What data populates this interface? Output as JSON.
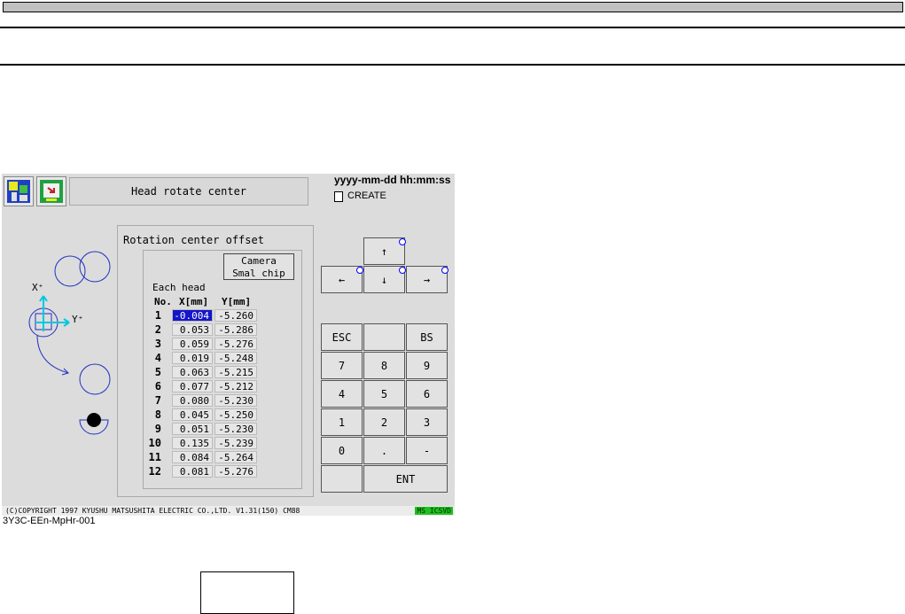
{
  "window": {
    "title": "Head rotate center",
    "datetime": "yyyy-mm-dd  hh:mm:ss",
    "mode": "CREATE"
  },
  "icons": [
    "home-icon",
    "screen-icon",
    "document-icon"
  ],
  "diagram": {
    "x_axis_label": "X⁺",
    "y_axis_label": "Y⁺"
  },
  "offset_panel": {
    "title": "Rotation center offset",
    "camera_button": "Camera\nSmal chip",
    "section_label": "Each head",
    "columns": [
      "No.",
      "X[mm]",
      "Y[mm]"
    ],
    "rows": [
      {
        "no": "1",
        "x": "-0.004",
        "y": "-5.260"
      },
      {
        "no": "2",
        "x": "0.053",
        "y": "-5.286"
      },
      {
        "no": "3",
        "x": "0.059",
        "y": "-5.276"
      },
      {
        "no": "4",
        "x": "0.019",
        "y": "-5.248"
      },
      {
        "no": "5",
        "x": "0.063",
        "y": "-5.215"
      },
      {
        "no": "6",
        "x": "0.077",
        "y": "-5.212"
      },
      {
        "no": "7",
        "x": "0.080",
        "y": "-5.230"
      },
      {
        "no": "8",
        "x": "0.045",
        "y": "-5.250"
      },
      {
        "no": "9",
        "x": "0.051",
        "y": "-5.230"
      },
      {
        "no": "10",
        "x": "0.135",
        "y": "-5.239"
      },
      {
        "no": "11",
        "x": "0.084",
        "y": "-5.264"
      },
      {
        "no": "12",
        "x": "0.081",
        "y": "-5.276"
      }
    ],
    "selected_row": "1"
  },
  "arrows": {
    "up": "↑",
    "left": "←",
    "down": "↓",
    "right": "→"
  },
  "keypad": {
    "esc": "ESC",
    "blank": "",
    "bs": "BS",
    "k7": "7",
    "k8": "8",
    "k9": "9",
    "k4": "4",
    "k5": "5",
    "k6": "6",
    "k1": "1",
    "k2": "2",
    "k3": "3",
    "k0": "0",
    "dot": ".",
    "minus": "-",
    "ent": "ENT"
  },
  "status": {
    "copyright": "(C)COPYRIGHT 1997 KYUSHU MATSUSHITA ELECTRIC CO.,LTD. V1.31(150)    CM88",
    "indicator": "MS  ICSVD"
  },
  "footer_code": "3Y3C-EEn-MpHr-001",
  "colors": {
    "accent_blue": "#1515c8",
    "screen_bg": "#dcdcdc",
    "diagram_blue": "#2030c0",
    "cyan": "#00c8e0"
  }
}
